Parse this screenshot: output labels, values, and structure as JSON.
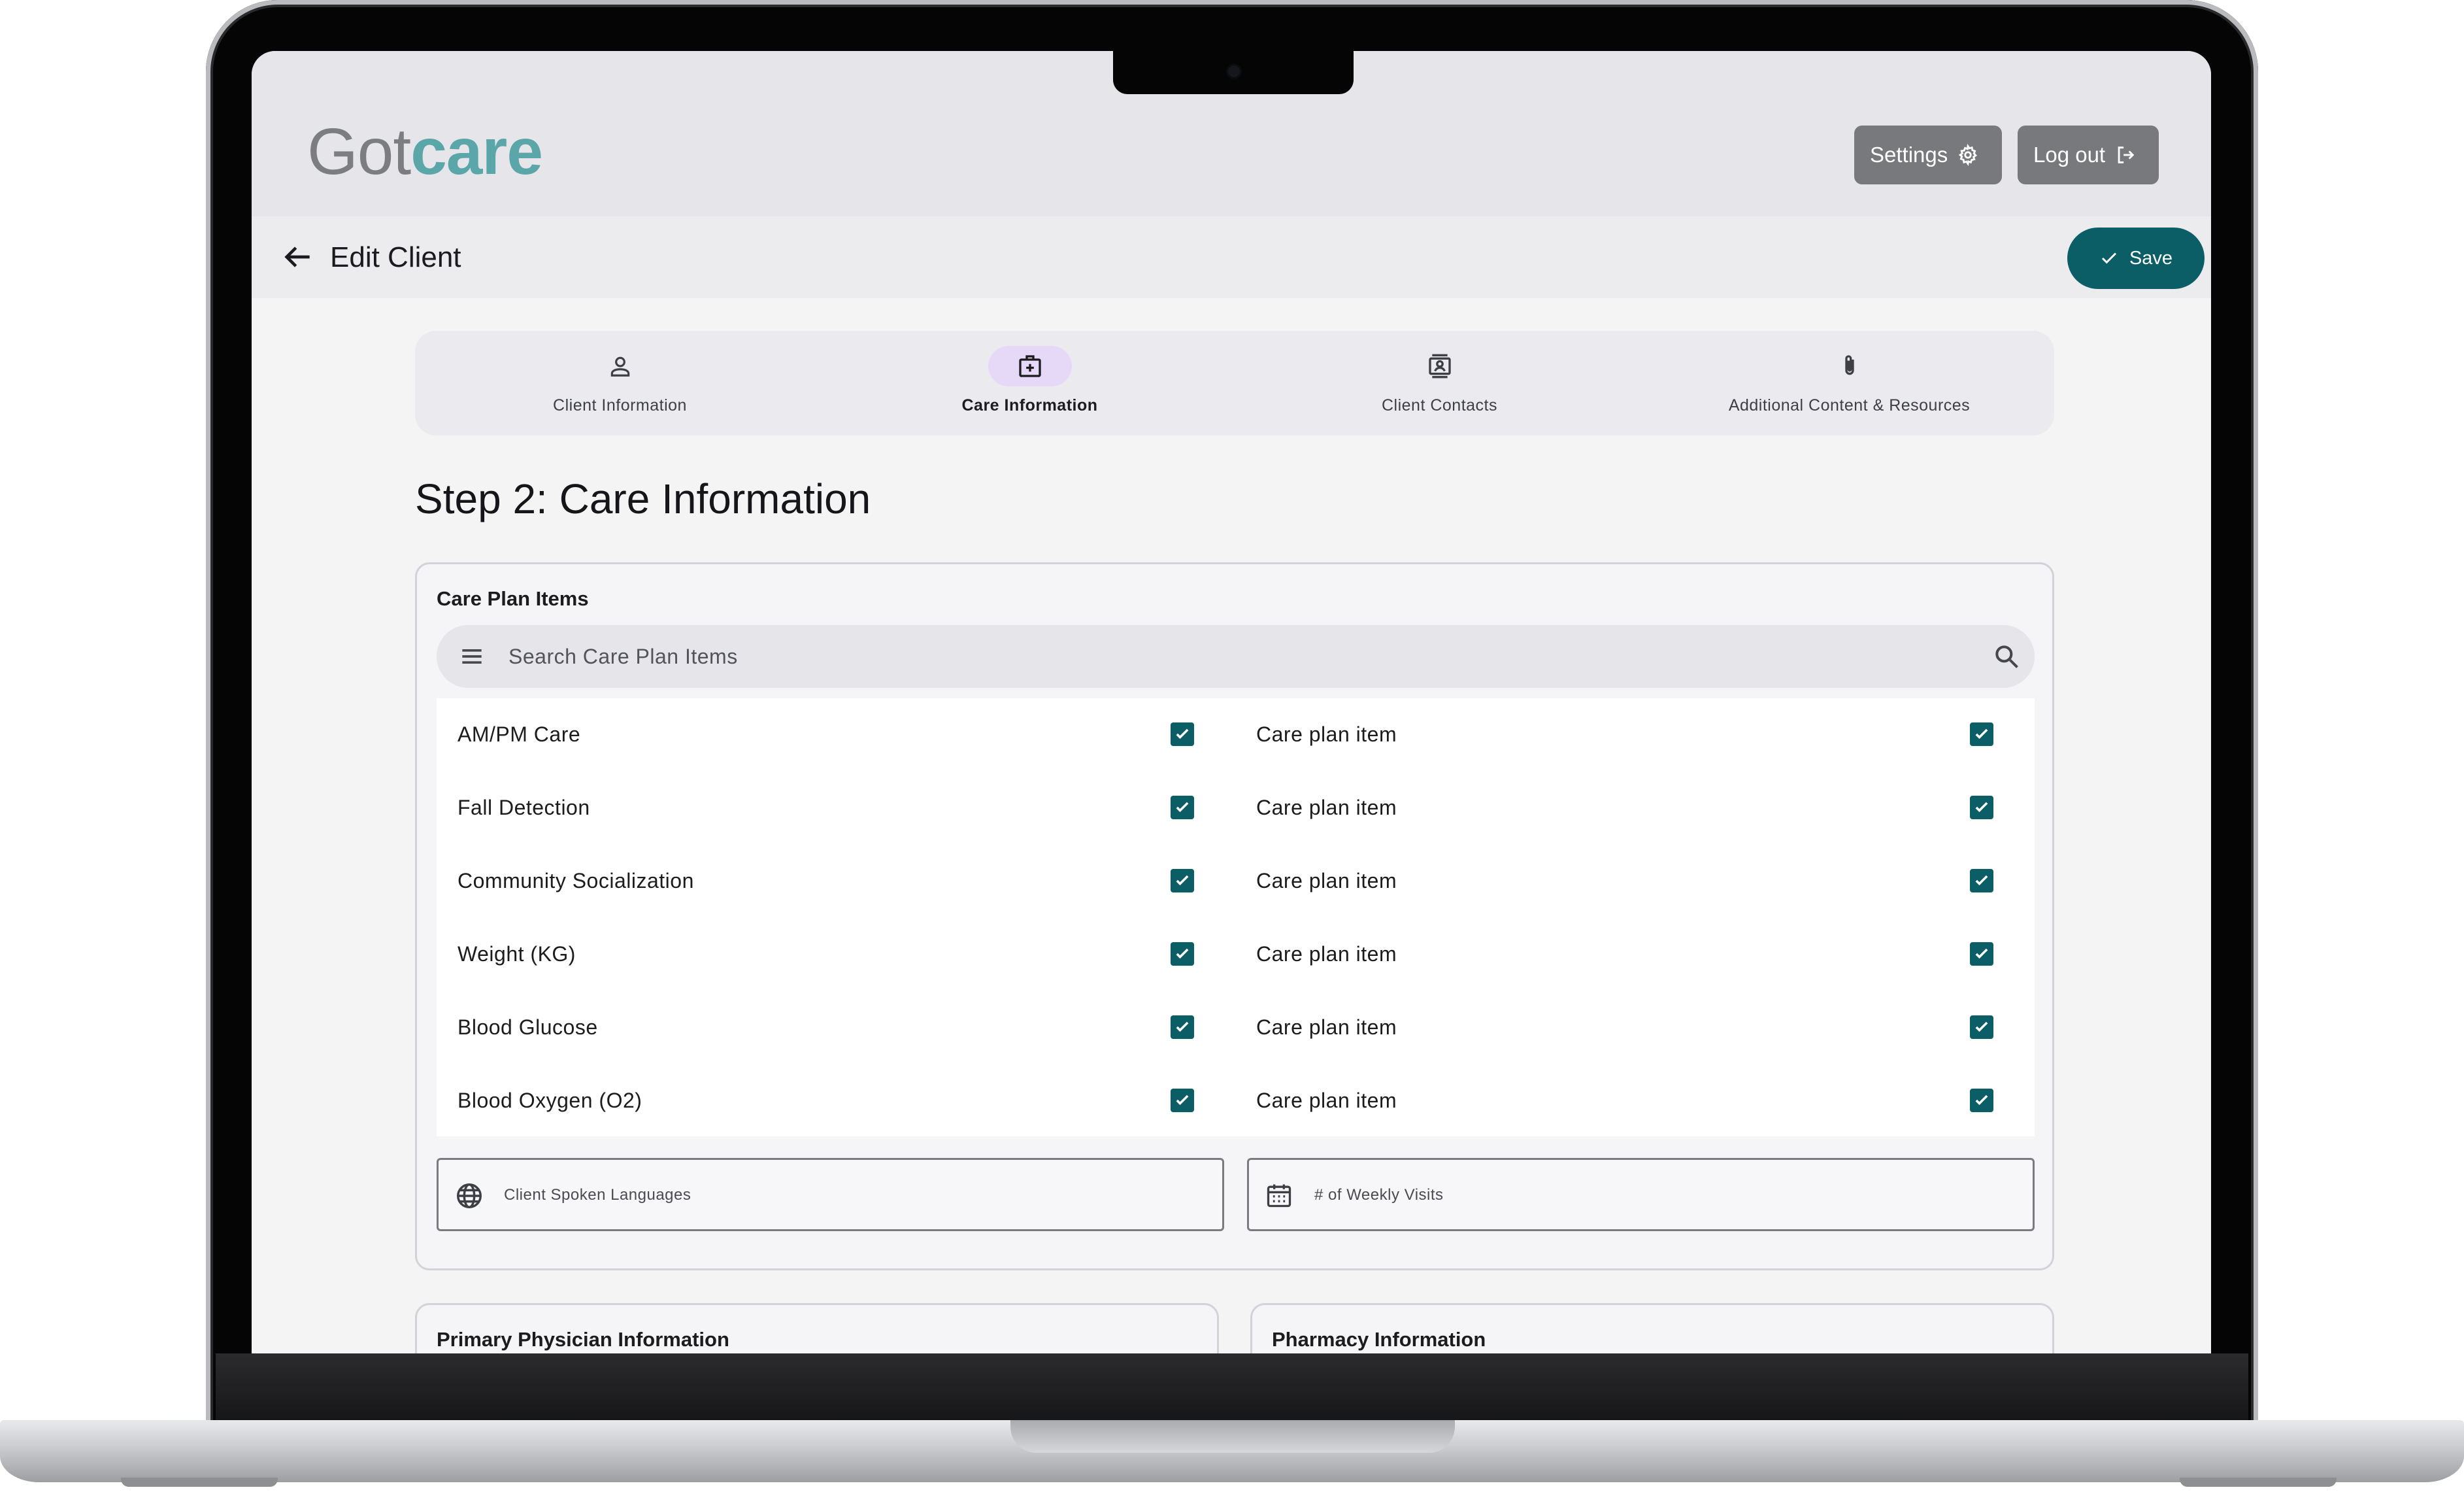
{
  "app": {
    "logo_part1": "Got",
    "logo_part2": "care",
    "accent_color": "#0b5e66",
    "logo_color": "#5aa6a8"
  },
  "header": {
    "settings_label": "Settings",
    "settings_icon": "gear-icon",
    "logout_label": "Log out",
    "logout_icon": "logout-icon"
  },
  "page": {
    "title": "Edit Client",
    "save_label": "Save"
  },
  "tabs": [
    {
      "label": "Client Information",
      "icon": "person-icon",
      "active": false
    },
    {
      "label": "Care Information",
      "icon": "medical-id-icon",
      "active": true
    },
    {
      "label": "Client Contacts",
      "icon": "contacts-icon",
      "active": false
    },
    {
      "label": "Additional Content & Resources",
      "icon": "paperclip-icon",
      "active": false
    }
  ],
  "step": {
    "title": "Step 2: Care Information"
  },
  "care_plan": {
    "title": "Care Plan Items",
    "search_placeholder": "Search Care Plan Items",
    "left_items": [
      {
        "label": "AM/PM Care",
        "checked": true
      },
      {
        "label": "Fall Detection",
        "checked": true
      },
      {
        "label": "Community Socialization",
        "checked": true
      },
      {
        "label": "Weight (KG)",
        "checked": true
      },
      {
        "label": "Blood Glucose",
        "checked": true
      },
      {
        "label": "Blood Oxygen (O2)",
        "checked": true
      }
    ],
    "right_items": [
      {
        "label": "Care plan item",
        "checked": true
      },
      {
        "label": "Care plan item",
        "checked": true
      },
      {
        "label": "Care plan item",
        "checked": true
      },
      {
        "label": "Care plan item",
        "checked": true
      },
      {
        "label": "Care plan item",
        "checked": true
      },
      {
        "label": "Care plan item",
        "checked": true
      }
    ]
  },
  "fields": {
    "languages_label": "Client Spoken Languages",
    "weekly_visits_label": "# of Weekly Visits"
  },
  "sections": {
    "physician_title": "Primary Physician Information",
    "pharmacy_title": "Pharmacy Information"
  }
}
